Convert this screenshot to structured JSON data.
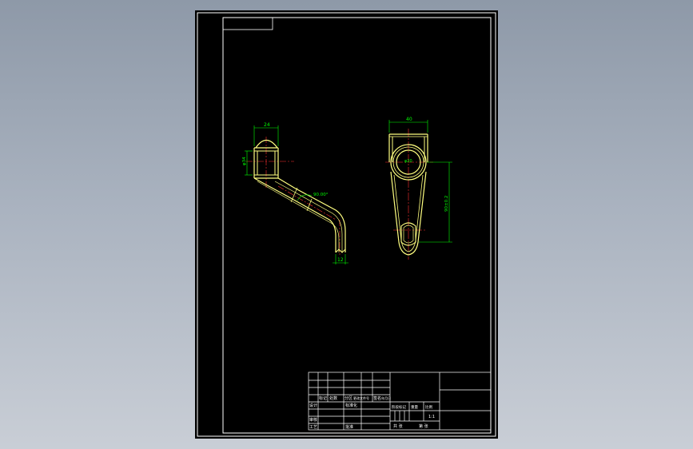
{
  "colors": {
    "background_top": "#8e99a8",
    "background_bottom": "#c9ced6",
    "sheet": "#000000",
    "border_lines": "#ffffff",
    "part_outline": "#ffff80",
    "dimensions": "#00ff00",
    "centerlines": "#ff3030"
  },
  "dimensions": {
    "side_top_width": "24",
    "side_bore_dia": "φ34",
    "side_angle": "90.00°",
    "side_bottom_width": "12",
    "front_top_width": "40",
    "front_bore_dia": "φ20",
    "front_height": "90±0.2"
  },
  "title_block": {
    "row_labels": {
      "designer": "设计",
      "checker": "审核",
      "process": "工艺"
    },
    "col_labels": {
      "mark": "标记",
      "count": "处数",
      "zone": "分区",
      "change_doc": "更改文件号",
      "signature": "签名",
      "date": "年月日"
    },
    "standardize": "标准化",
    "approve": "批准",
    "stage_label": "阶段标记",
    "weight_label": "重量",
    "scale_label": "比例",
    "scale_value": "1:1",
    "sheet_total": "共  张",
    "sheet_num": "第  张"
  }
}
